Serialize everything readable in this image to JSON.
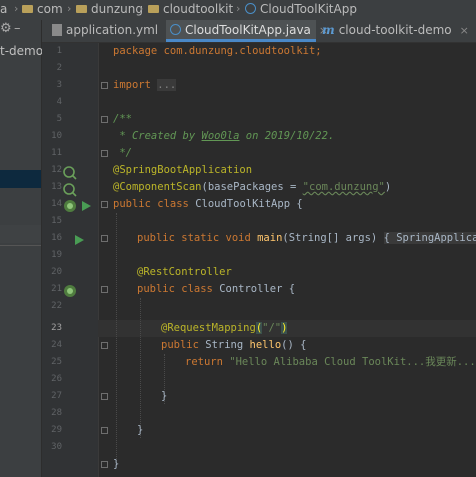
{
  "breadcrumb": {
    "root_partial": "a",
    "items": [
      "com",
      "dunzung",
      "cloudtoolkit",
      "CloudToolKitApp"
    ],
    "sep": "›"
  },
  "sidebar": {
    "gear_icon": "gear-icon",
    "collapse_glyph": "–",
    "project_label": "t-demo"
  },
  "tabs": [
    {
      "label": "application.yml",
      "icon": "yml-file-icon",
      "close": "×"
    },
    {
      "label": "CloudToolKitApp.java",
      "icon": "java-class-icon",
      "close": "×",
      "active": true
    },
    {
      "label": "cloud-toolkit-demo",
      "icon": "maven-m-icon",
      "close": "×"
    }
  ],
  "gutter": {
    "line_numbers": [
      "1",
      "2",
      "3",
      "4",
      "5",
      "6",
      "10",
      "11",
      "12",
      "13",
      "14",
      "15",
      "16",
      "19",
      "20",
      "21",
      "22",
      "23",
      "24",
      "25",
      "26",
      "27",
      "28",
      "29",
      "30"
    ]
  },
  "code": {
    "l1": [
      "package com.dunzung.cloudtoolkit;"
    ],
    "l3": [
      "import ",
      "..."
    ],
    "l6": [
      "/**"
    ],
    "l10": [
      " * Created by ",
      "Woo0la",
      " on 2019/10/22."
    ],
    "l11": [
      " */"
    ],
    "l12": [
      "@SpringBootApplication"
    ],
    "l13": [
      "@ComponentScan",
      "(basePackages = ",
      "\"com.dunzung\"",
      ")"
    ],
    "l14": [
      "public class ",
      "CloudToolKitApp {"
    ],
    "l16": [
      "public static void ",
      "main",
      "(String[] args) ",
      "{ SpringApplicati"
    ],
    "l20": [
      "@RestController"
    ],
    "l21": [
      "public class ",
      "Controller {"
    ],
    "l23": [
      "@RequestMapping",
      "(",
      "\"/\"",
      ")"
    ],
    "l24": [
      "public ",
      "String ",
      "hello",
      "() {"
    ],
    "l25": [
      "return ",
      "\"Hello Alibaba Cloud ToolKit...我更新....\""
    ],
    "l27": [
      "}"
    ],
    "l29": [
      "}"
    ],
    "l30": [
      "}"
    ]
  },
  "colors": {
    "keyword": "#cc7832",
    "annotation": "#bbb529",
    "string": "#6a8759",
    "comment": "#629755",
    "method": "#ffc66d",
    "text": "#a9b7c6"
  }
}
